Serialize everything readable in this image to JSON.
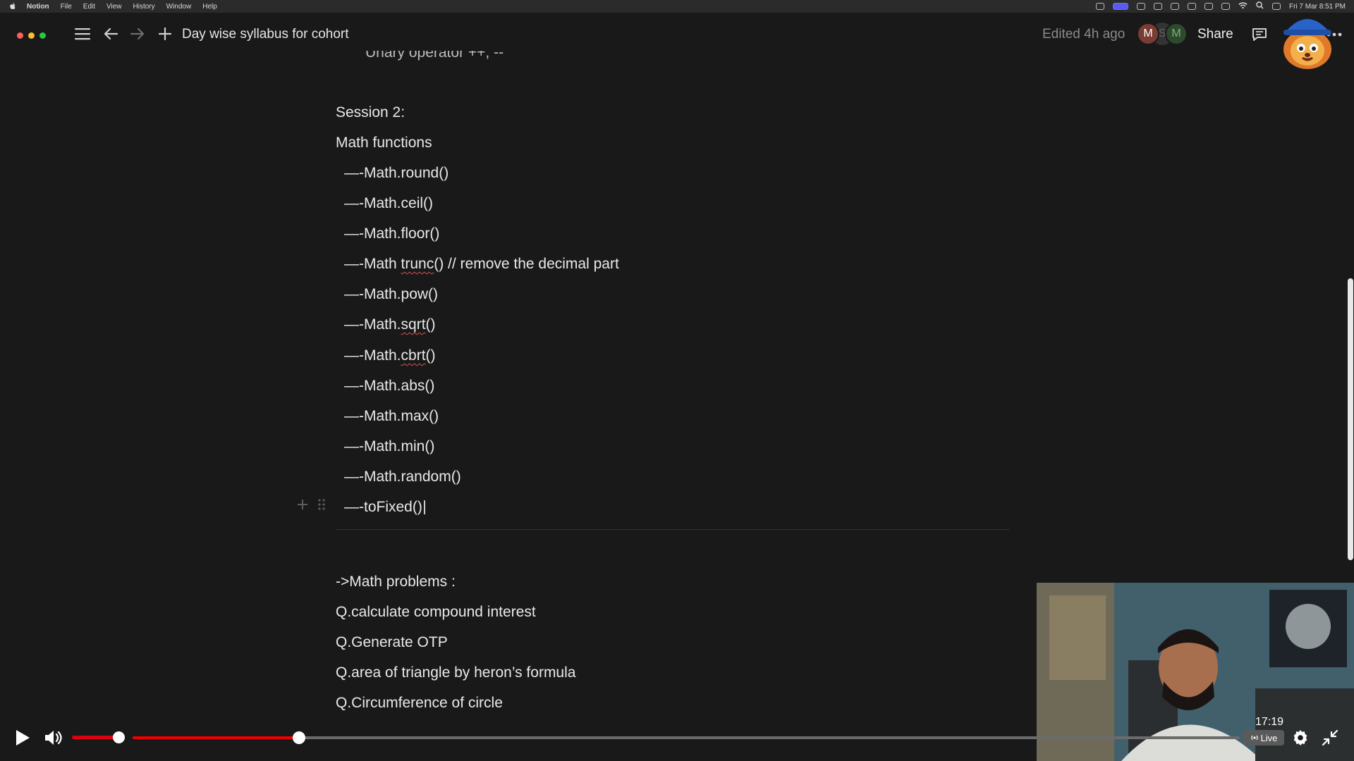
{
  "menubar": {
    "app": "Notion",
    "items": [
      "File",
      "Edit",
      "View",
      "History",
      "Window",
      "Help"
    ],
    "clock": "Fri 7 Mar  8:51 PM"
  },
  "topbar": {
    "breadcrumb": "Day wise syllabus for cohort",
    "edited": "Edited 4h ago",
    "avatars": [
      "M",
      "S",
      "M"
    ],
    "share_label": "Share"
  },
  "document": {
    "cut_line": "Unary operator   ++, --",
    "session_heading": "Session 2:",
    "math_functions_heading": "Math functions",
    "math_items": [
      "—-Math.round()",
      "—-Math.ceil()",
      "—-Math.floor()",
      "—-Math trunc() // remove the decimal part",
      "—-Math.pow()",
      "—-Math.sqrt()",
      "—-Math.cbrt()",
      "—-Math.abs()",
      "—-Math.max()",
      "—-Math.min()",
      "—-Math.random()",
      "—-toFixed()"
    ],
    "problems_heading": "->Math problems :",
    "problems": [
      "Q.calculate compound interest",
      "Q.Generate OTP",
      "Q.area of triangle by heron’s formula",
      "Q.Circumference of circle"
    ]
  },
  "player": {
    "time": "17:19",
    "live_label": "Live",
    "volume_fraction": 0.85,
    "progress_fraction": 0.15
  },
  "colors": {
    "background": "#191919",
    "text": "#e9e9e9",
    "muted": "#8a8a8a",
    "player_red": "#e00000"
  }
}
